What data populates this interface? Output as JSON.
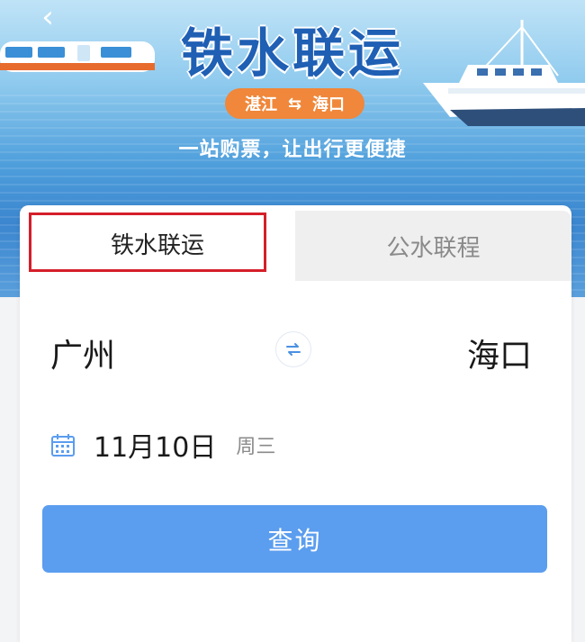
{
  "header": {
    "back_icon": "chevron-left-icon",
    "title": "铁水联运",
    "route": {
      "from": "湛江",
      "to": "海口",
      "swap_icon": "swap-arrows-icon"
    },
    "slogan": "一站购票，让出行更便捷"
  },
  "tabs": [
    {
      "label": "铁水联运",
      "active": true
    },
    {
      "label": "公水联程",
      "active": false
    }
  ],
  "form": {
    "from_city": "广州",
    "to_city": "海口",
    "swap_icon": "swap-circle-icon",
    "date": "11月10日",
    "weekday": "周三",
    "calendar_icon": "calendar-icon"
  },
  "search_button": "查询",
  "colors": {
    "accent_blue": "#5b9def",
    "title_blue": "#1f5fb4",
    "route_orange": "#f0873a",
    "highlight_red": "#d51f2a"
  }
}
